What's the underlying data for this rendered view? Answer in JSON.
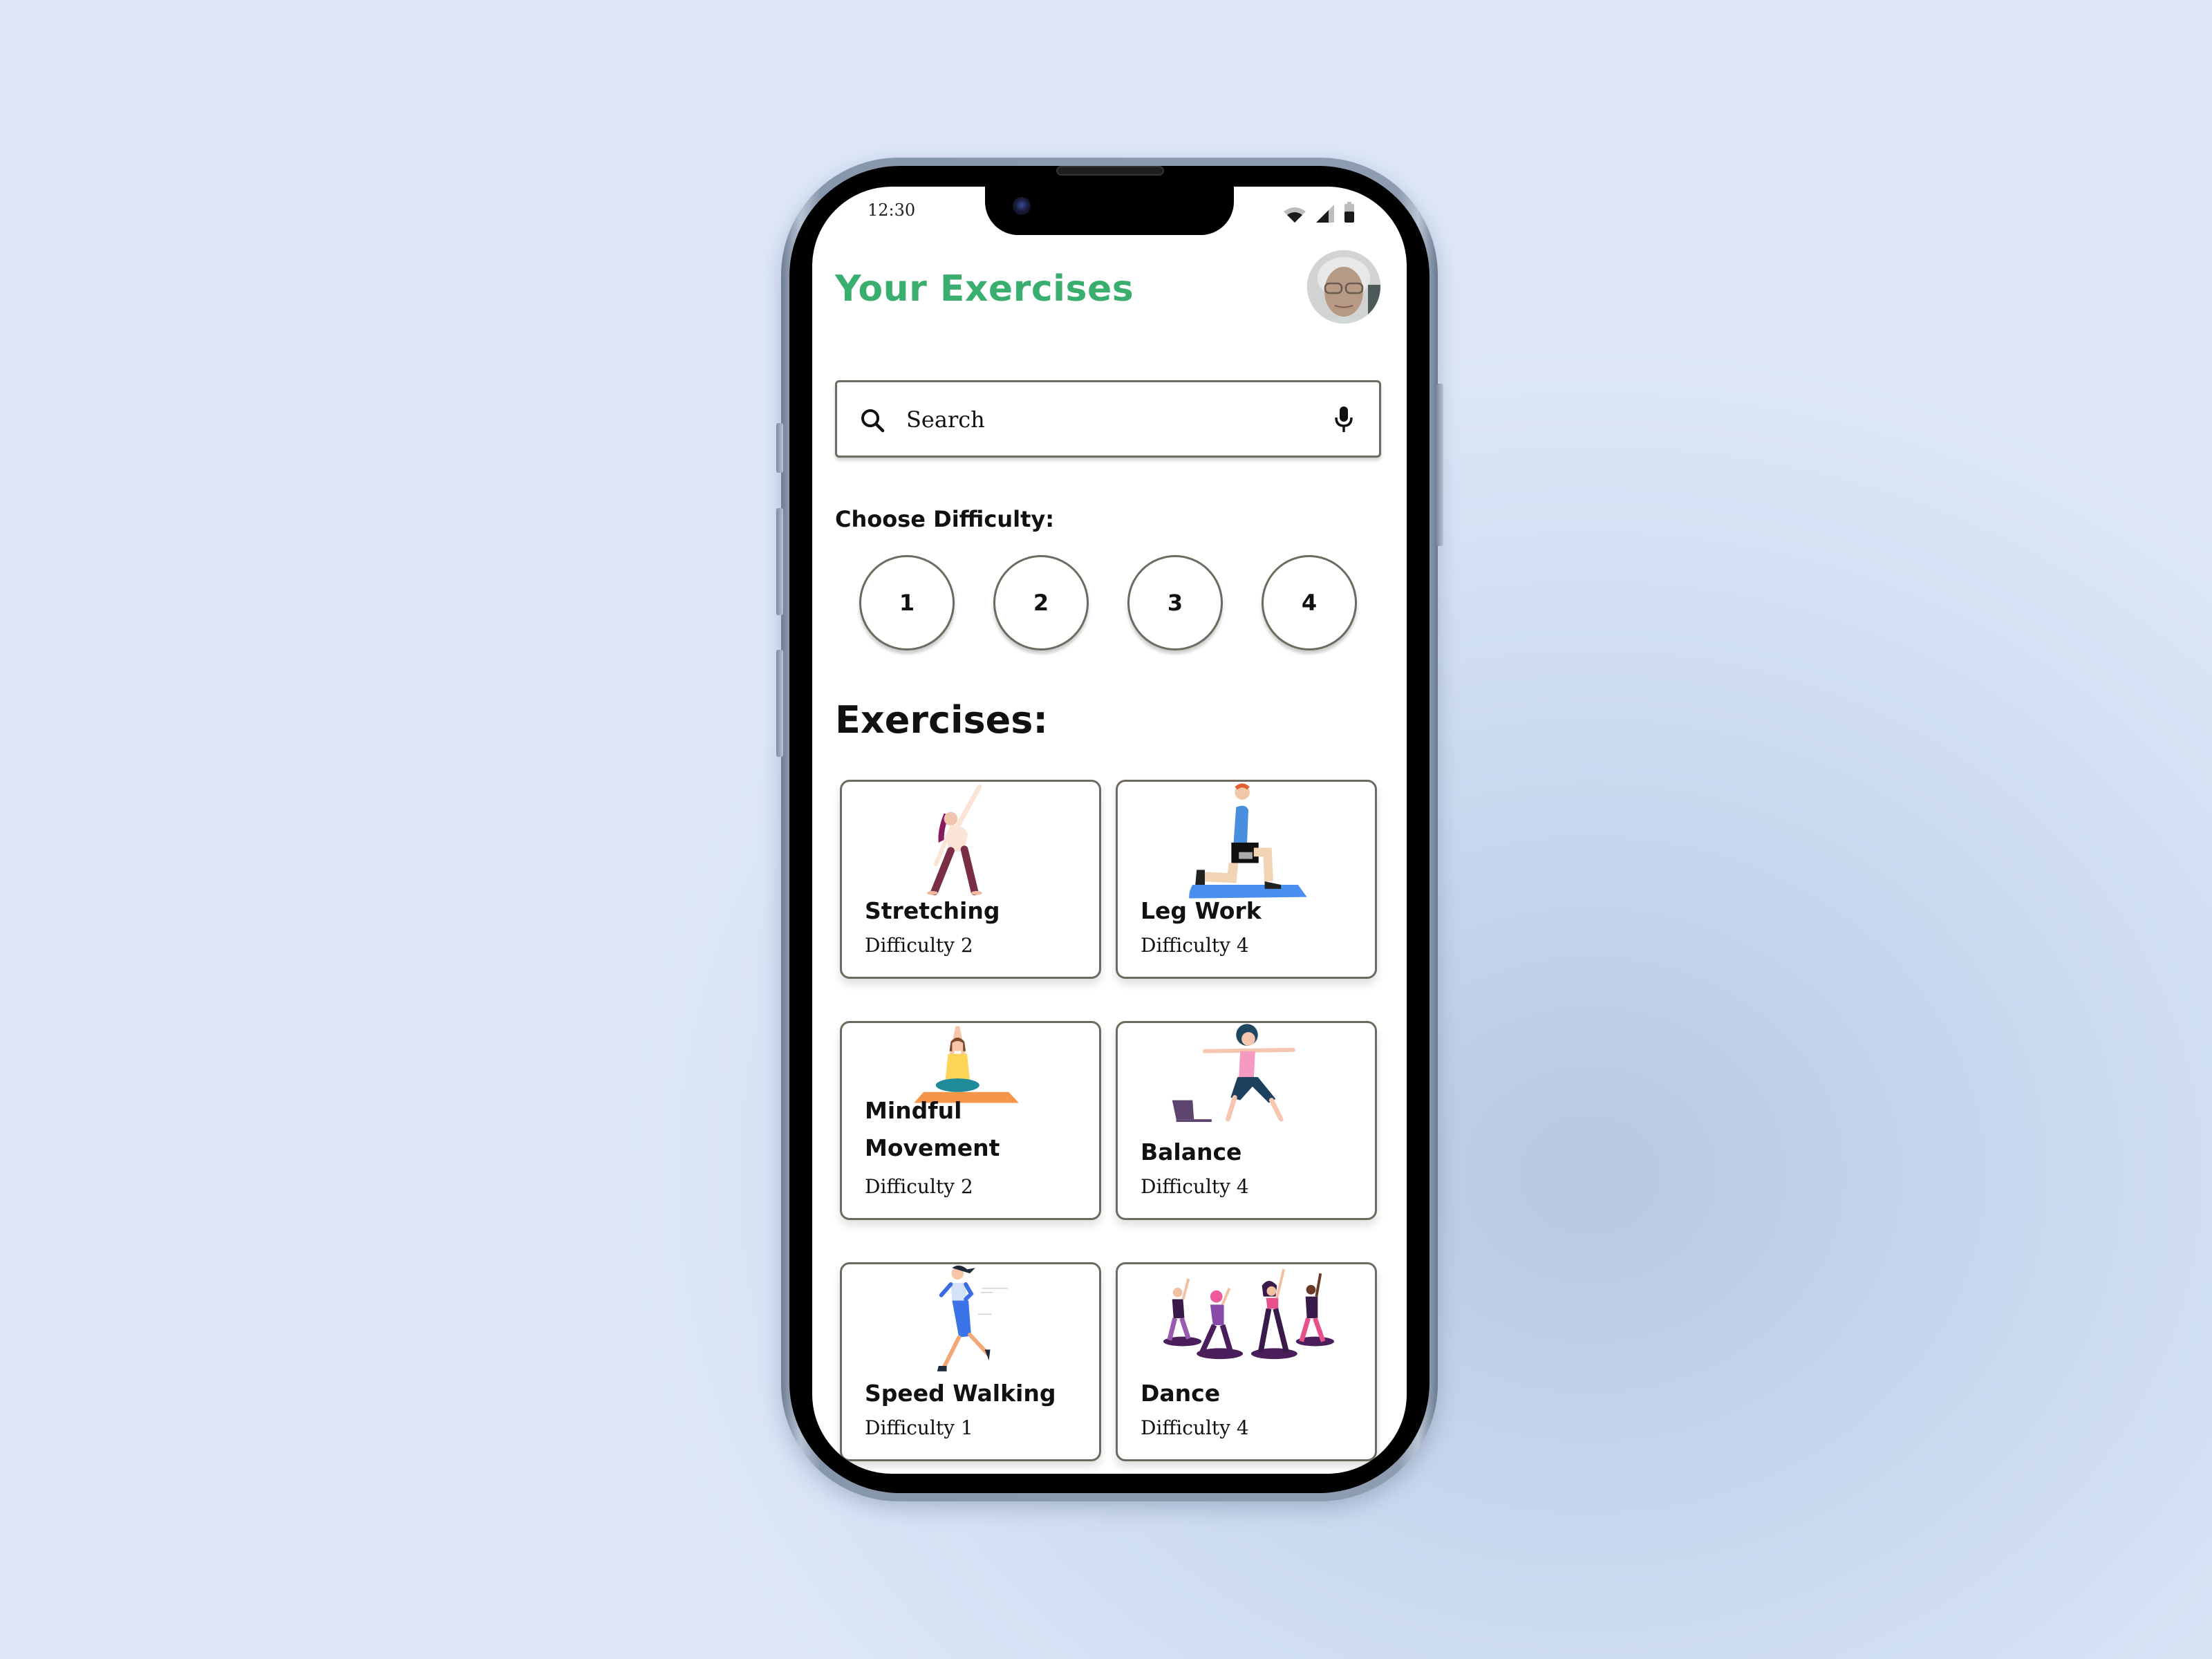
{
  "status_bar": {
    "time": "12:30",
    "icons": [
      "wifi-icon",
      "signal-icon",
      "battery-icon"
    ]
  },
  "header": {
    "title": "Your Exercises",
    "avatar_alt": "User profile photo"
  },
  "search": {
    "placeholder": "Search",
    "value": ""
  },
  "difficulty": {
    "label": "Choose Difficulty:",
    "options": [
      "1",
      "2",
      "3",
      "4"
    ]
  },
  "exercises": {
    "label": "Exercises:",
    "items": [
      {
        "name": "Stretching",
        "difficulty": "Difficulty 2",
        "illustration": "stretching-illustration"
      },
      {
        "name": "Leg Work",
        "difficulty": "Difficulty 4",
        "illustration": "lunge-illustration"
      },
      {
        "name": "Mindful Movement",
        "name_line1": "Mindful",
        "name_line2": "Movement",
        "difficulty": "Difficulty 2",
        "illustration": "meditation-illustration"
      },
      {
        "name": "Balance",
        "difficulty": "Difficulty 4",
        "illustration": "balance-illustration"
      },
      {
        "name": "Speed Walking",
        "difficulty": "Difficulty 1",
        "illustration": "walking-illustration"
      },
      {
        "name": "Dance",
        "difficulty": "Difficulty 4",
        "illustration": "dance-illustration"
      }
    ]
  },
  "colors": {
    "accent": "#3aae6e",
    "border": "#6f6a60",
    "text": "#111111"
  }
}
